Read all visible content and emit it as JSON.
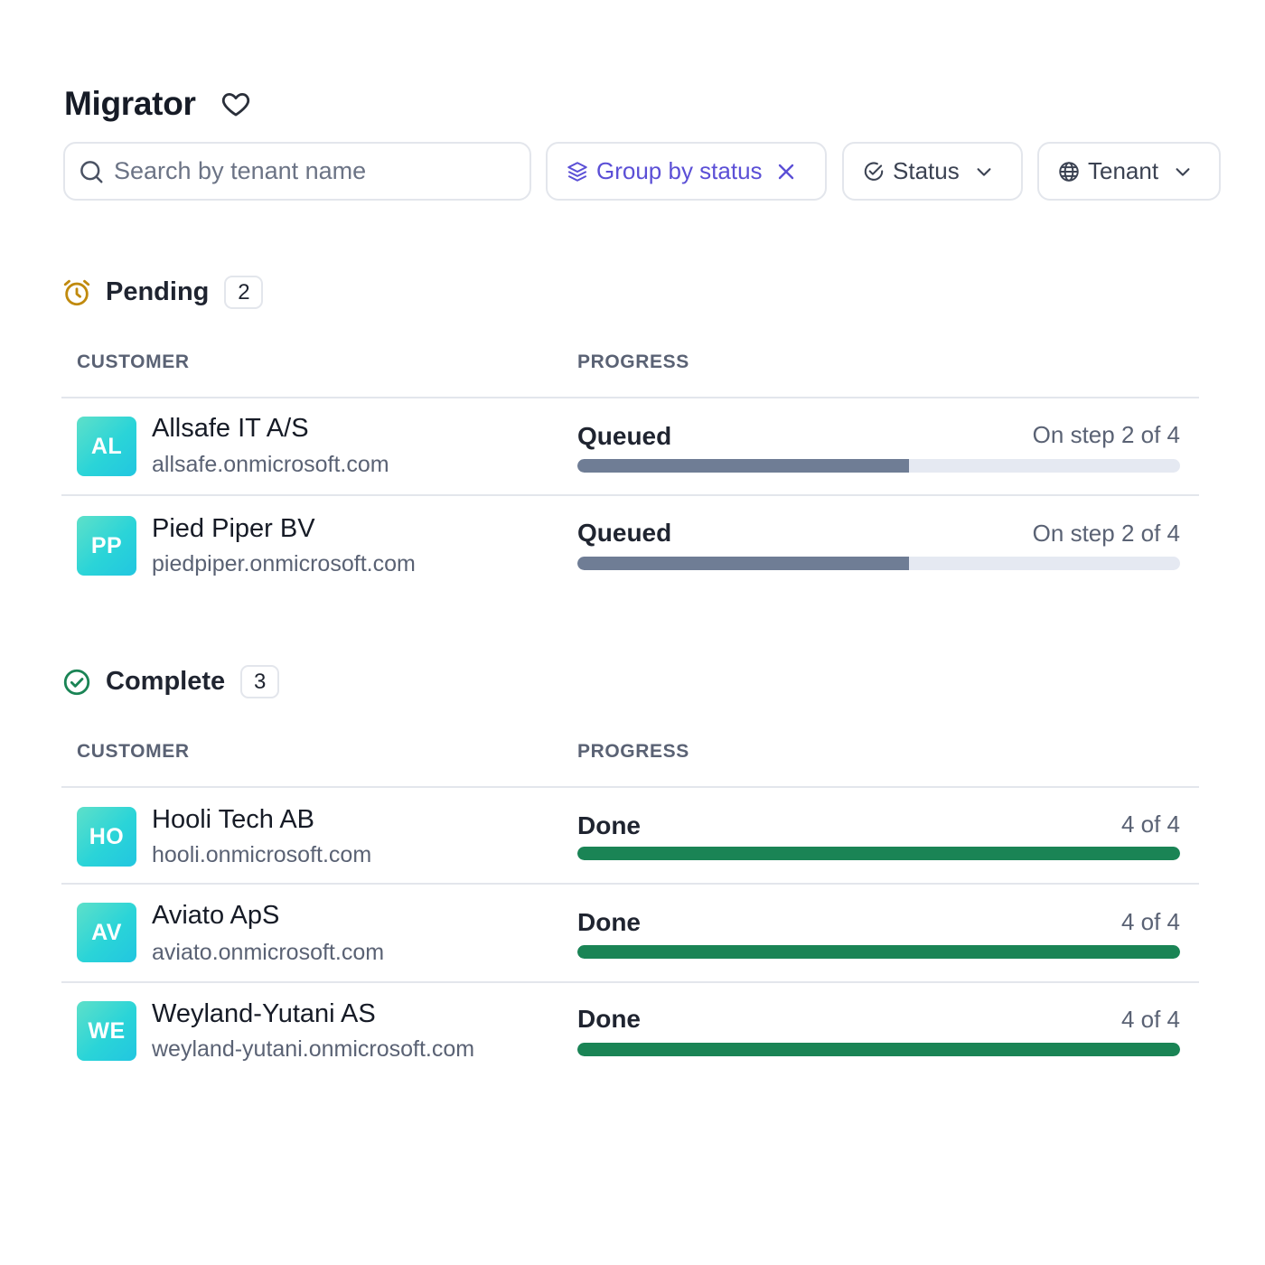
{
  "app": {
    "title": "Migrator"
  },
  "filters": {
    "search_placeholder": "Search by tenant name",
    "group_label": "Group by status",
    "status_label": "Status",
    "tenant_label": "Tenant"
  },
  "columns": {
    "customer": "CUSTOMER",
    "progress": "PROGRESS"
  },
  "colors": {
    "accent": "#5b4fd6",
    "pending": "#c08a0e",
    "complete": "#1a8455",
    "queued_fill": "#6f7d95",
    "track": "#e5e9f2"
  },
  "groups": [
    {
      "name": "Pending",
      "count": "2",
      "icon": "alarm-clock-icon",
      "rows": [
        {
          "initials": "AL",
          "name": "Allsafe IT A/S",
          "domain": "allsafe.onmicrosoft.com",
          "status": "Queued",
          "step_text": "On step 2 of 4",
          "progress": 0.55
        },
        {
          "initials": "PP",
          "name": "Pied Piper BV",
          "domain": "piedpiper.onmicrosoft.com",
          "status": "Queued",
          "step_text": "On step 2 of 4",
          "progress": 0.55
        }
      ]
    },
    {
      "name": "Complete",
      "count": "3",
      "icon": "check-circle-icon",
      "rows": [
        {
          "initials": "HO",
          "name": "Hooli Tech AB",
          "domain": "hooli.onmicrosoft.com",
          "status": "Done",
          "step_text": "4 of 4",
          "progress": 1.0
        },
        {
          "initials": "AV",
          "name": "Aviato ApS",
          "domain": "aviato.onmicrosoft.com",
          "status": "Done",
          "step_text": "4 of 4",
          "progress": 1.0
        },
        {
          "initials": "WE",
          "name": "Weyland-Yutani AS",
          "domain": "weyland-yutani.onmicrosoft.com",
          "status": "Done",
          "step_text": "4 of 4",
          "progress": 1.0
        }
      ]
    }
  ]
}
